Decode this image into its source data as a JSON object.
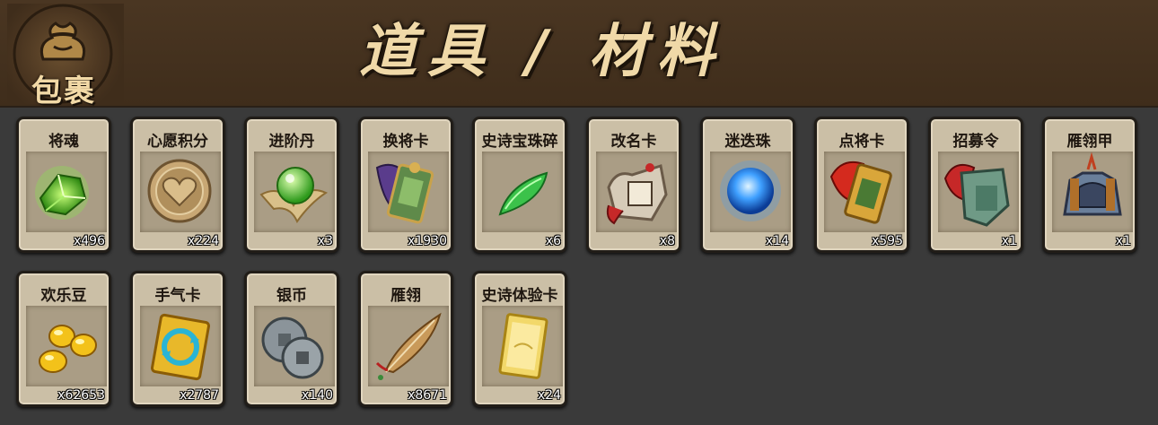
{
  "header": {
    "bag_label": "包裹",
    "title": "道具 / 材料"
  },
  "colors": {
    "header_bg": "#43301e",
    "page_bg": "#3a3a3a",
    "card_bg": "#cbbfa6",
    "title_text": "#f0d9a8"
  },
  "items": [
    {
      "name": "将魂",
      "count": "x496",
      "icon": "green-crystal-icon"
    },
    {
      "name": "心愿积分",
      "count": "x224",
      "icon": "heart-coin-icon"
    },
    {
      "name": "进阶丹",
      "count": "x3",
      "icon": "green-pill-icon"
    },
    {
      "name": "换将卡",
      "count": "x1930",
      "icon": "general-swap-card-icon"
    },
    {
      "name": "史诗宝珠碎",
      "count": "x6",
      "icon": "jade-shard-icon"
    },
    {
      "name": "改名卡",
      "count": "x8",
      "icon": "rename-card-icon"
    },
    {
      "name": "迷迭珠",
      "count": "x14",
      "icon": "blue-orb-icon"
    },
    {
      "name": "点将卡",
      "count": "x595",
      "icon": "general-select-card-icon"
    },
    {
      "name": "招募令",
      "count": "x1",
      "icon": "recruit-token-icon"
    },
    {
      "name": "雁翎甲",
      "count": "x1",
      "icon": "armor-icon"
    },
    {
      "name": "欢乐豆",
      "count": "x62653",
      "icon": "gold-beans-icon"
    },
    {
      "name": "手气卡",
      "count": "x2787",
      "icon": "luck-card-icon"
    },
    {
      "name": "银币",
      "count": "x140",
      "icon": "silver-coins-icon"
    },
    {
      "name": "雁翎",
      "count": "x8671",
      "icon": "feather-icon"
    },
    {
      "name": "史诗体验卡",
      "count": "x24",
      "icon": "gold-card-icon"
    }
  ]
}
